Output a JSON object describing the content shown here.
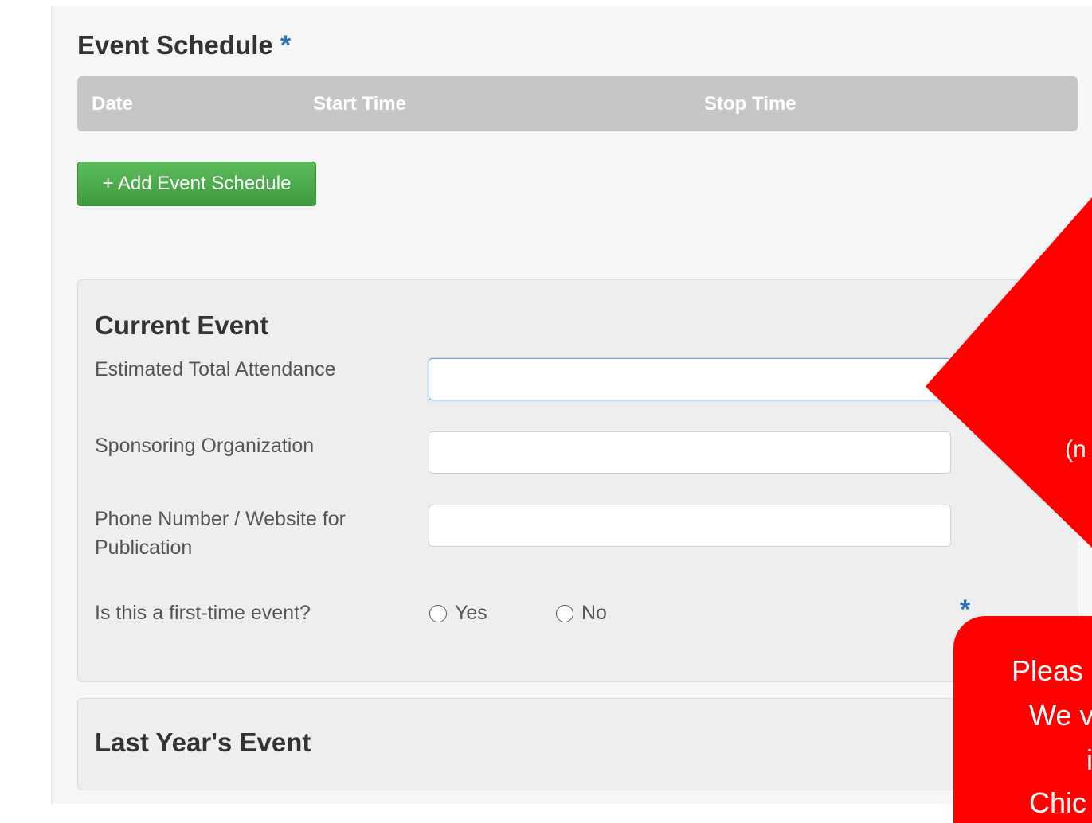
{
  "event_schedule": {
    "title": "Event Schedule",
    "required_marker": "*",
    "columns": [
      "Date",
      "Start Time",
      "Stop Time"
    ],
    "add_button_label": "+ Add Event Schedule"
  },
  "current_event": {
    "title": "Current Event",
    "fields": [
      {
        "label": "Estimated Total Attendance",
        "value": "",
        "focused": true
      },
      {
        "label": "Sponsoring Organization",
        "value": ""
      },
      {
        "label": "Phone Number / Website for Publication",
        "value": ""
      }
    ],
    "first_time_question": {
      "label": "Is this a first-time event?",
      "options": [
        "Yes",
        "No"
      ],
      "selected": null,
      "required_marker": "*"
    }
  },
  "last_year_event": {
    "title": "Last Year's Event"
  },
  "annotations": {
    "diamond_fragment": "(n",
    "box_lines": [
      "Pleas",
      "We v",
      "i",
      "Chic"
    ]
  },
  "colors": {
    "accent_blue": "#2d73b8",
    "button_green": "#4cae4c",
    "header_gray": "#c6c6c6",
    "callout_red": "#ff0000"
  }
}
